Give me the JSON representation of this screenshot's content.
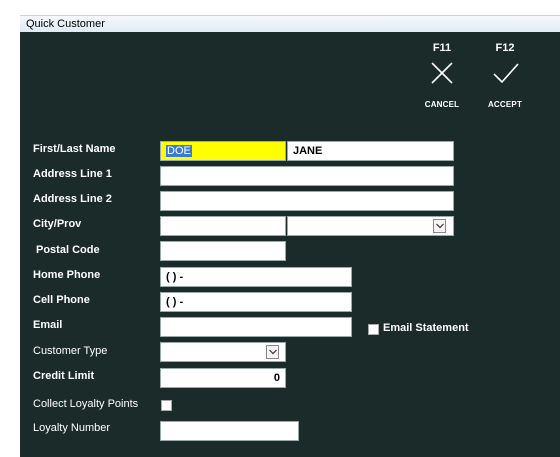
{
  "window": {
    "title": "Quick Customer"
  },
  "actions": {
    "cancel": {
      "key": "F11",
      "label": "CANCEL",
      "icon": "close-icon"
    },
    "accept": {
      "key": "F12",
      "label": "ACCEPT",
      "icon": "check-icon"
    }
  },
  "form": {
    "first_last_name": {
      "label": "First/Last Name",
      "last_value": "DOE",
      "first_value": "JANE"
    },
    "address1": {
      "label": "Address Line 1",
      "value": ""
    },
    "address2": {
      "label": "Address Line 2",
      "value": ""
    },
    "city_prov": {
      "label": "City/Prov",
      "city_value": "",
      "prov_value": ""
    },
    "postal_code": {
      "label": "Postal Code",
      "value": ""
    },
    "home_phone": {
      "label": "Home Phone",
      "value": "( )  -"
    },
    "cell_phone": {
      "label": "Cell Phone",
      "value": "( )  -"
    },
    "email": {
      "label": "Email",
      "value": ""
    },
    "email_statement": {
      "label": "Email Statement",
      "checked": false
    },
    "customer_type": {
      "label": "Customer Type",
      "value": ""
    },
    "credit_limit": {
      "label": "Credit Limit",
      "value": "0"
    },
    "collect_loyalty": {
      "label": "Collect Loyalty Points",
      "checked": false
    },
    "loyalty_number": {
      "label": "Loyalty Number",
      "value": ""
    }
  },
  "colors": {
    "background": "#1b2b29",
    "highlight": "#ffff00",
    "selection": "#3a7bd5"
  }
}
